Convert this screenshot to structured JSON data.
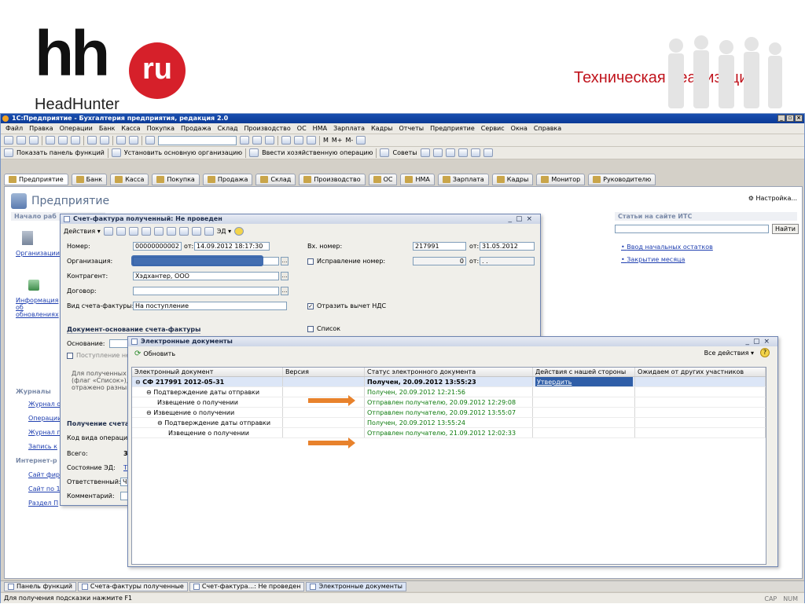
{
  "slide": {
    "logo_main": "hh",
    "logo_ru": "ru",
    "logo_sub": "HeadHunter",
    "title": "Техническая реализация"
  },
  "app": {
    "title": "1С:Предприятие - Бухгалтерия предприятия, редакция 2.0",
    "menu": [
      "Файл",
      "Правка",
      "Операции",
      "Банк",
      "Касса",
      "Покупка",
      "Продажа",
      "Склад",
      "Производство",
      "ОС",
      "НМА",
      "Зарплата",
      "Кадры",
      "Отчеты",
      "Предприятие",
      "Сервис",
      "Окна",
      "Справка"
    ],
    "toolbar_text": [
      "М",
      "М+",
      "М-"
    ],
    "toolbar2": [
      "Показать панель функций",
      "Установить основную организацию",
      "Ввести хозяйственную операцию",
      "Советы"
    ],
    "sections": [
      "Предприятие",
      "Банк",
      "Касса",
      "Покупка",
      "Продажа",
      "Склад",
      "Производство",
      "ОС",
      "НМА",
      "Зарплата",
      "Кадры",
      "Монитор",
      "Руководителю"
    ],
    "page_title": "Предприятие",
    "settings": "Настройка...",
    "left_head": "Начало раб",
    "left_links": [
      "Организации",
      "Информация об обновлениях"
    ],
    "journals_head": "Журналы",
    "journals": [
      "Журнал о",
      "Операции",
      "Журнал п",
      "Запись к"
    ],
    "internet_head": "Интернет-р",
    "internet": [
      "Сайт фирм",
      "Сайт по 1С",
      "Раздел П"
    ],
    "its_head": "Статьи на сайте ИТС",
    "its_find": "Найти",
    "its_links": [
      "Ввод начальных остатков",
      "Закрытие месяца"
    ]
  },
  "invoice": {
    "title": "Счет-фактура полученный: Не проведен",
    "actions": "Действия",
    "ed": "ЭД",
    "number_label": "Номер:",
    "number": "00000000002",
    "from_label": "от:",
    "date": "14.09.2012 18:17:30",
    "in_number_label": "Вх. номер:",
    "in_number": "217991",
    "in_date": "31.05.2012",
    "org_label": "Организация:",
    "fix_label": "Исправление номер:",
    "fix_value": "0",
    "fix_date": ". .",
    "contractor_label": "Контрагент:",
    "contractor": "Хэдхантер, ООО",
    "contract_label": "Договор:",
    "kind_label": "Вид счета-фактуры:",
    "kind": "На поступление",
    "vat_label": "Отразить вычет НДС",
    "basis_head": "Документ-основание счета-фактуры",
    "basis_label": "Основание:",
    "list_label": "Список",
    "arrival_label": "Поступление не",
    "note": "Для полученных сч (флаг «Список»), е отражено разным",
    "receive_head": "Получение счета",
    "code_label": "Код вида операции",
    "total_label": "Всего:",
    "total_value": "3",
    "state_label": "Состояние ЭД:",
    "state_value": "Т",
    "resp_label": "Ответственный:",
    "resp_value": "Ч",
    "comment_label": "Комментарий:"
  },
  "edocs": {
    "title": "Электронные документы",
    "refresh": "Обновить",
    "all_actions": "Все действия",
    "columns": [
      "Электронный документ",
      "Версия",
      "Статус электронного документа",
      "Действия с нашей стороны",
      "Ожидаем от других участников"
    ],
    "rows": [
      {
        "doc": "СФ 217991 2012-05-31",
        "indent": 0,
        "toggle": "⊖",
        "status": "Получен, 20.09.2012 13:55:23",
        "action": "Утвердить",
        "bold": true
      },
      {
        "doc": "Подтверждение даты отправки",
        "indent": 1,
        "toggle": "⊖",
        "status": "Получен, 20.09.2012 12:21:56",
        "action": "",
        "bold": false
      },
      {
        "doc": "Извещение о получении",
        "indent": 2,
        "toggle": "",
        "status": "Отправлен получателю, 20.09.2012 12:29:08",
        "action": "",
        "bold": false
      },
      {
        "doc": "Извещение о получении",
        "indent": 1,
        "toggle": "⊖",
        "status": "Отправлен получателю, 20.09.2012 13:55:07",
        "action": "",
        "bold": false
      },
      {
        "doc": "Подтверждение даты отправки",
        "indent": 2,
        "toggle": "⊖",
        "status": "Получен, 20.09.2012 13:55:24",
        "action": "",
        "bold": false
      },
      {
        "doc": "Извещение о получении",
        "indent": 3,
        "toggle": "",
        "status": "Отправлен получателю, 21.09.2012 12:02:33",
        "action": "",
        "bold": false
      }
    ]
  },
  "taskbar": [
    "Панель функций",
    "Счета-фактуры полученные",
    "Счет-фактура...: Не проведен",
    "Электронные документы"
  ],
  "status": {
    "hint": "Для получения подсказки нажмите F1",
    "cap": "CAP",
    "num": "NUM"
  }
}
